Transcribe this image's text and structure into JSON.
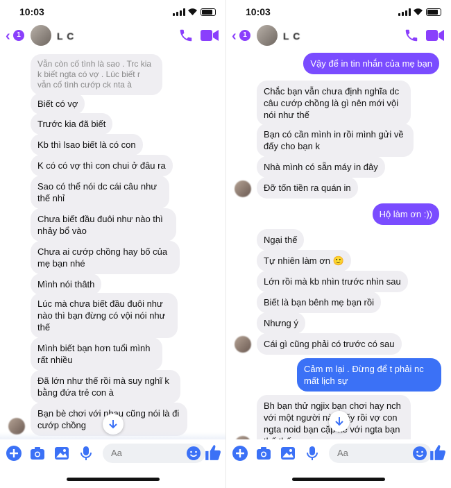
{
  "status": {
    "time": "10:03"
  },
  "header": {
    "back_badge": "1",
    "contact_name": "L  C"
  },
  "left": {
    "messages": [
      "Vẫn còn cố tình là sao . Trc kia k biết ngta có vợ . Lúc biết r vẫn cố tình cướp ck nta à",
      "Biết có vợ",
      "Trước kia đã biết",
      "Kb thì lsao biết là có con",
      "K có có vợ  thì con chui ở đâu ra",
      "Sao có thể nói dc cái câu như thế nhỉ",
      "Chưa biết đầu đuôi như nào thì nhảy bổ vào",
      "Chưa ai cướp chồng hay bố của mẹ bạn nhé",
      "Mình nói thâth",
      "Lúc mà chưa biết đầu đuôi như nào thì bạn đừng có vội nói như thế",
      "Mình biết bạn hơn tuổi mình rất nhiều",
      "Đã lớn như thế rồi mà suy nghĩ k bằng đứa trẻ con à",
      "Bạn bè chơi với nhau cũng nói là đi cướp chồng"
    ]
  },
  "right": {
    "messages": [
      "Vậy để in tin nhắn của mẹ bạn",
      "Chắc bạn vẫn chưa định nghĩa dc câu cướp chồng là gì nên mới vội nói như thế",
      "Bạn có cần mình in rồi mình gửi về đấy cho bạn k",
      "Nhà mình có sẵn máy in đây",
      "Đỡ tốn tiền ra quán in",
      "Hộ làm ơn :))",
      "Ngại thế",
      "Tự nhiên làm ơn 🙂",
      "Lớn rồi mà kb nhìn trước nhìn sau",
      "Biết là bạn bênh mẹ bạn rồi",
      "Nhưng ý",
      "Cái gì cũng phải có trước có sau",
      "Cảm               m lại . Đừng để t phải nc mất lịch sự",
      "Bh bạn thử ngjix bạn chơi hay nch với một người nào đấy rồi vợ con ngta noid bạn cặp kè với ngta bạn thế thế"
    ]
  },
  "composer": {
    "placeholder": "Aa"
  },
  "colors": {
    "accent": "#8a3ffc",
    "outgoing": "#7a4cff",
    "outgoing_blue": "#3b71f6",
    "incoming": "#efeef2"
  }
}
